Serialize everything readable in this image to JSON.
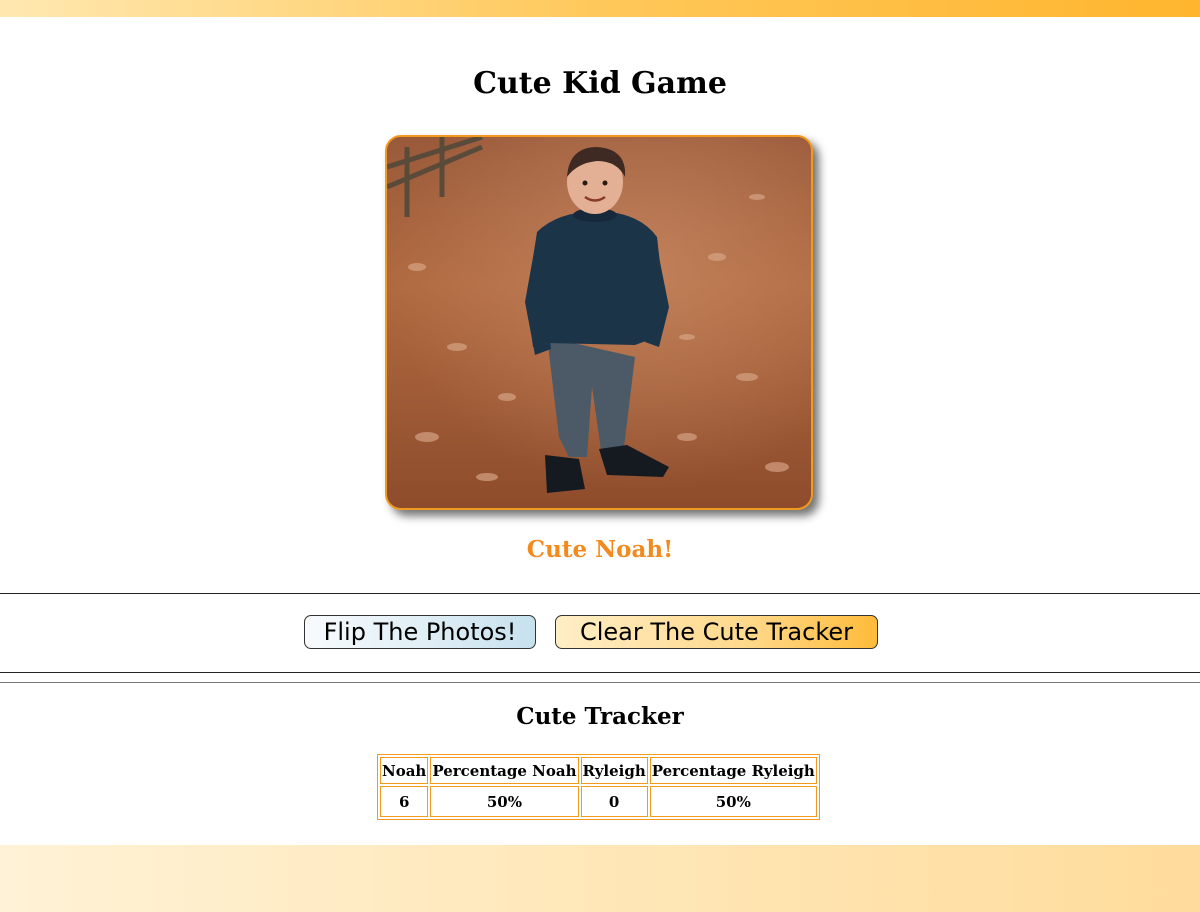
{
  "page": {
    "title": "Cute Kid Game",
    "caption": "Cute Noah!",
    "accent_color": "#f28a1e",
    "top_bar_colors": [
      "#ffe8b0",
      "#ffb52e"
    ]
  },
  "photo": {
    "subject": "child-photo"
  },
  "buttons": {
    "flip_label": "Flip The Photos!",
    "clear_label": "Clear The Cute Tracker"
  },
  "tracker": {
    "title": "Cute Tracker",
    "headers": [
      "Noah",
      "Percentage Noah",
      "Ryleigh",
      "Percentage Ryleigh"
    ],
    "row": [
      "6",
      "50%",
      "0",
      "50%"
    ]
  }
}
